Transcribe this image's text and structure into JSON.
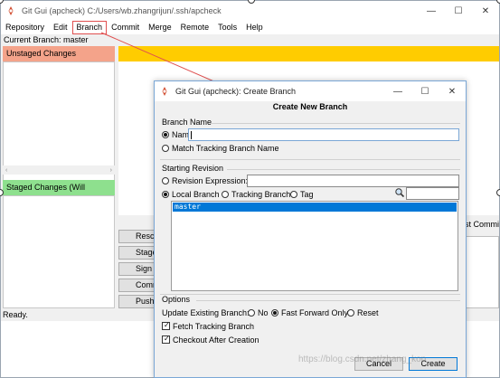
{
  "window": {
    "title": "Git Gui (apcheck) C:/Users/wb.zhangrijun/.ssh/apcheck",
    "minimize": "—",
    "maximize": "☐",
    "close": "✕"
  },
  "menu": {
    "items": [
      "Repository",
      "Edit",
      "Branch",
      "Commit",
      "Merge",
      "Remote",
      "Tools",
      "Help"
    ]
  },
  "current_branch": "Current Branch: master",
  "panes": {
    "unstaged": "Unstaged Changes",
    "staged": "Staged Changes (Will Commit)"
  },
  "commit_buttons": {
    "rescan": "Rescan",
    "stage": "Stage Changed",
    "signoff": "Sign Off",
    "commit": "Commit",
    "push": "Push"
  },
  "amend_label": "st Commi",
  "status": "Ready.",
  "dialog": {
    "title": "Git Gui (apcheck): Create Branch",
    "heading": "Create New Branch",
    "branch_name_group": "Branch Name",
    "name_label": "Name:",
    "name_value": "",
    "match_tracking": "Match Tracking Branch Name",
    "starting_revision_group": "Starting Revision",
    "revision_expression": "Revision Expression:",
    "local_branch": "Local Branch",
    "tracking_branch": "Tracking Branch",
    "tag": "Tag",
    "branches": [
      "master"
    ],
    "options_group": "Options",
    "update_existing": "Update Existing Branch:",
    "opt_no": "No",
    "opt_ff": "Fast Forward Only",
    "opt_reset": "Reset",
    "fetch_tracking": "Fetch Tracking Branch",
    "checkout_after": "Checkout After Creation",
    "cancel": "Cancel",
    "create": "Create"
  },
  "watermark": "https://blog.csdn.net/zhang_kop",
  "colors": {
    "unstaged_header": "#f4a38a",
    "staged_header": "#8ee08e",
    "diff_header": "#ffcc00",
    "selection": "#0078d7",
    "annotation": "#e05050"
  }
}
